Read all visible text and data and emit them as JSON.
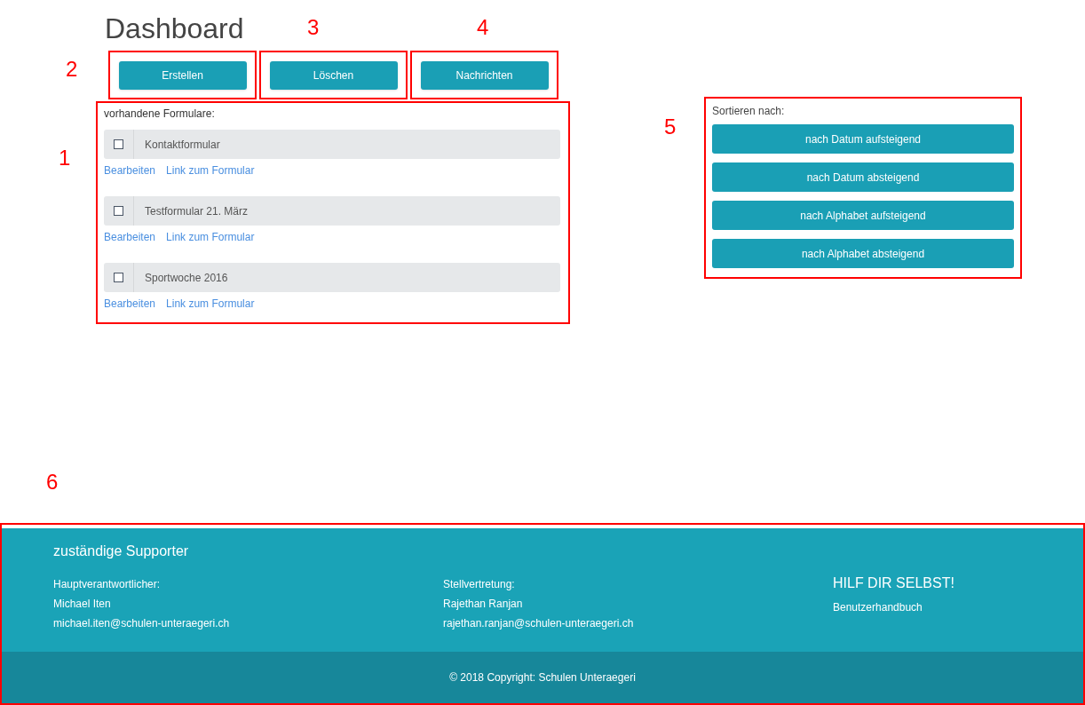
{
  "title": "Dashboard",
  "actions": [
    {
      "label": "Erstellen"
    },
    {
      "label": "Löschen"
    },
    {
      "label": "Nachrichten"
    }
  ],
  "forms": {
    "heading": "vorhandene Formulare:",
    "items": [
      {
        "name": "Kontaktformular",
        "checked": false,
        "links": [
          "Bearbeiten",
          "Link zum Formular"
        ]
      },
      {
        "name": "Testformular 21. März",
        "checked": false,
        "links": [
          "Bearbeiten",
          "Link zum Formular"
        ]
      },
      {
        "name": "Sportwoche 2016",
        "checked": false,
        "links": [
          "Bearbeiten",
          "Link zum Formular"
        ]
      }
    ]
  },
  "sort": {
    "heading": "Sortieren nach:",
    "options": [
      "nach Datum aufsteigend",
      "nach Datum absteigend",
      "nach Alphabet aufsteigend",
      "nach Alphabet absteigend"
    ]
  },
  "footer": {
    "heading": "zuständige Supporter",
    "columns": [
      {
        "lines": [
          "Hauptverantwortlicher:",
          "Michael Iten",
          "michael.iten@schulen-unteraegeri.ch"
        ]
      },
      {
        "lines": [
          "Stellvertretung:",
          "Rajethan Ranjan",
          "rajethan.ranjan@schulen-unteraegeri.ch"
        ]
      }
    ],
    "help": {
      "title": "HILF DIR SELBST!",
      "link": "Benutzerhandbuch"
    },
    "copyright": "© 2018 Copyright: Schulen Unteraegeri"
  },
  "annotations": [
    "1",
    "2",
    "3",
    "4",
    "5",
    "6"
  ]
}
